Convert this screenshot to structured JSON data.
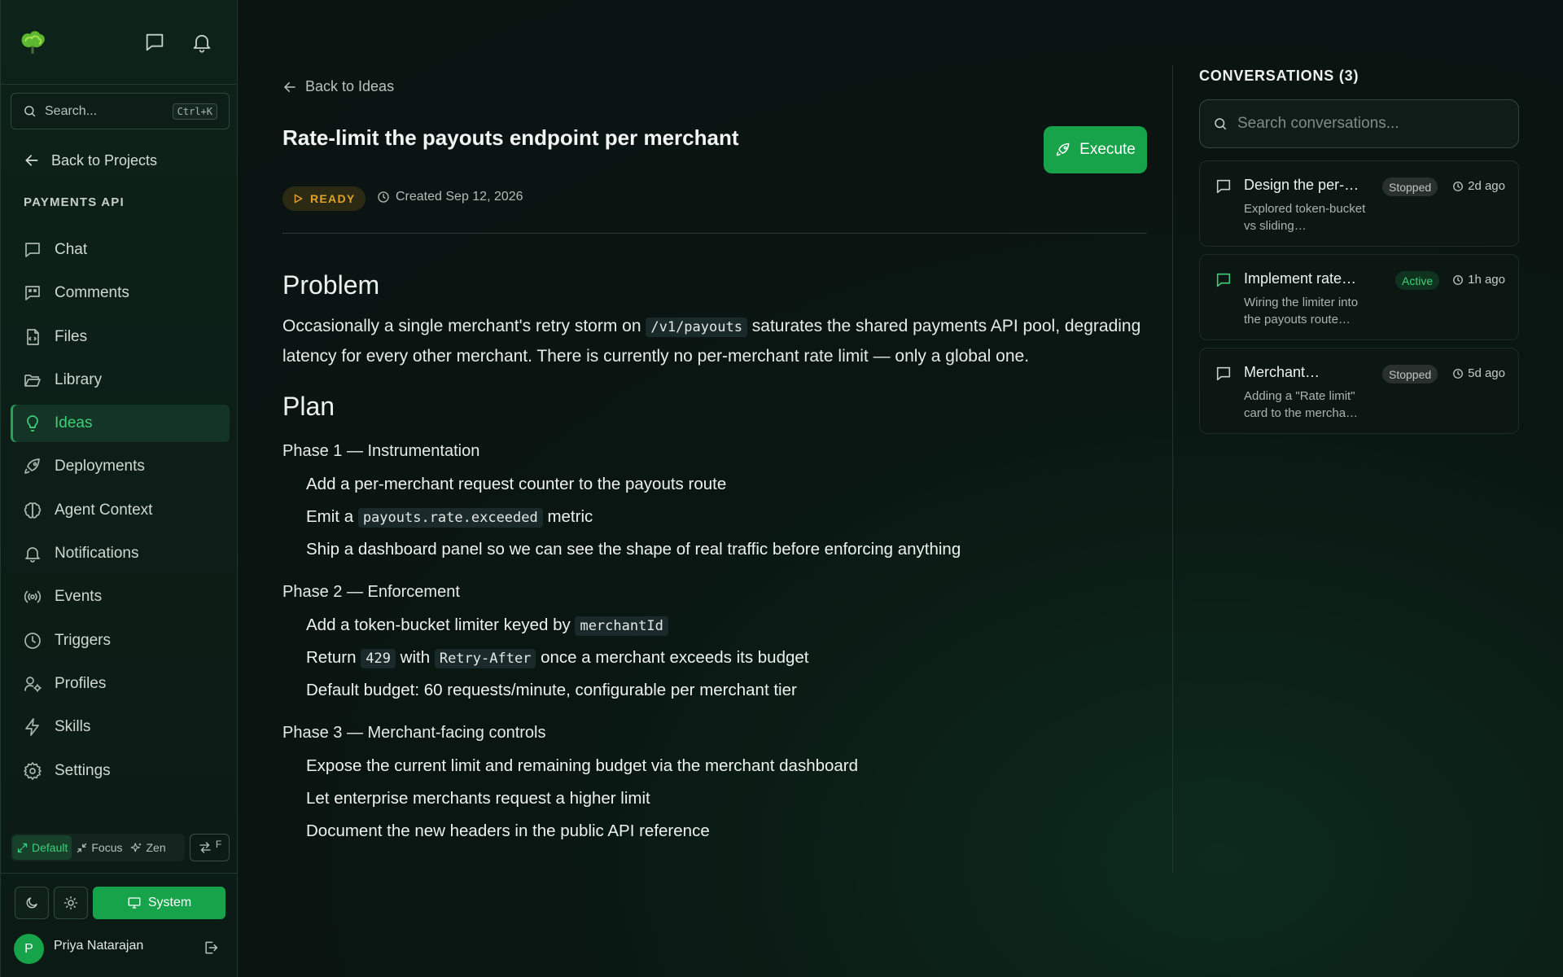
{
  "sidebar": {
    "search_placeholder": "Search...",
    "search_shortcut": "Ctrl+K",
    "back_to_projects": "Back to Projects",
    "project_name": "PAYMENTS API",
    "items": [
      {
        "label": "Chat",
        "icon": "chat-icon"
      },
      {
        "label": "Comments",
        "icon": "comments-icon"
      },
      {
        "label": "Files",
        "icon": "file-code-icon"
      },
      {
        "label": "Library",
        "icon": "folder-open-icon"
      },
      {
        "label": "Ideas",
        "icon": "lightbulb-icon",
        "active": true
      },
      {
        "label": "Deployments",
        "icon": "rocket-icon"
      },
      {
        "label": "Agent Context",
        "icon": "brain-icon"
      },
      {
        "label": "Notifications",
        "icon": "bell-icon"
      },
      {
        "label": "Events",
        "icon": "radio-broadcast-icon"
      },
      {
        "label": "Triggers",
        "icon": "clock-icon"
      },
      {
        "label": "Profiles",
        "icon": "user-cog-icon"
      },
      {
        "label": "Skills",
        "icon": "lightning-icon"
      },
      {
        "label": "Settings",
        "icon": "gear-icon"
      }
    ],
    "modes": {
      "default": "Default",
      "focus": "Focus",
      "zen": "Zen",
      "active": "Default"
    },
    "swap_key": "F",
    "theme_system": "System",
    "user": {
      "initial": "P",
      "name": "Priya Natarajan"
    }
  },
  "main": {
    "back_label": "Back to Ideas",
    "title": "Rate-limit the payouts endpoint per merchant",
    "execute_label": "Execute",
    "status": "READY",
    "created": "Created Sep 12, 2026",
    "problem": {
      "heading": "Problem",
      "text_before": "Occasionally a single merchant's retry storm on",
      "code": "/v1/payouts",
      "text_after": "saturates the shared payments API pool, degrading latency for every other merchant. There is currently no per-merchant rate limit — only a global one."
    },
    "plan": {
      "heading": "Plan",
      "phase1": {
        "title": "Phase 1 — Instrumentation",
        "s1": "Add a per-merchant request counter to the payouts route",
        "s2_a": "Emit a",
        "s2_code": "payouts.rate.exceeded",
        "s2_b": "metric",
        "s3": "Ship a dashboard panel so we can see the shape of real traffic before enforcing anything"
      },
      "phase2": {
        "title": "Phase 2 — Enforcement",
        "s1_a": "Add a token-bucket limiter keyed by",
        "s1_code": "merchantId",
        "s2_a": "Return",
        "s2_code1": "429",
        "s2_b": "with",
        "s2_code2": "Retry-After",
        "s2_c": "once a merchant exceeds its budget",
        "s3": "Default budget: 60 requests/minute, configurable per merchant tier"
      },
      "phase3": {
        "title": "Phase 3 — Merchant-facing controls",
        "s1": "Expose the current limit and remaining budget via the merchant dashboard",
        "s2": "Let enterprise merchants request a higher limit",
        "s3": "Document the new headers in the public API reference"
      }
    }
  },
  "conversations": {
    "heading": "CONVERSATIONS (3)",
    "search_placeholder": "Search conversations...",
    "items": [
      {
        "title": "Design the per-…",
        "desc": "Explored token-bucket vs sliding…",
        "status": "Stopped",
        "time": "2d ago"
      },
      {
        "title": "Implement rate…",
        "desc": "Wiring the limiter into the payouts route…",
        "status": "Active",
        "time": "1h ago"
      },
      {
        "title": "Merchant…",
        "desc": "Adding a \"Rate limit\" card to the mercha…",
        "status": "Stopped",
        "time": "5d ago"
      }
    ]
  },
  "colors": {
    "accent": "#16a34a",
    "accent_text": "#3ecf78",
    "ready": "#e0a22a"
  }
}
